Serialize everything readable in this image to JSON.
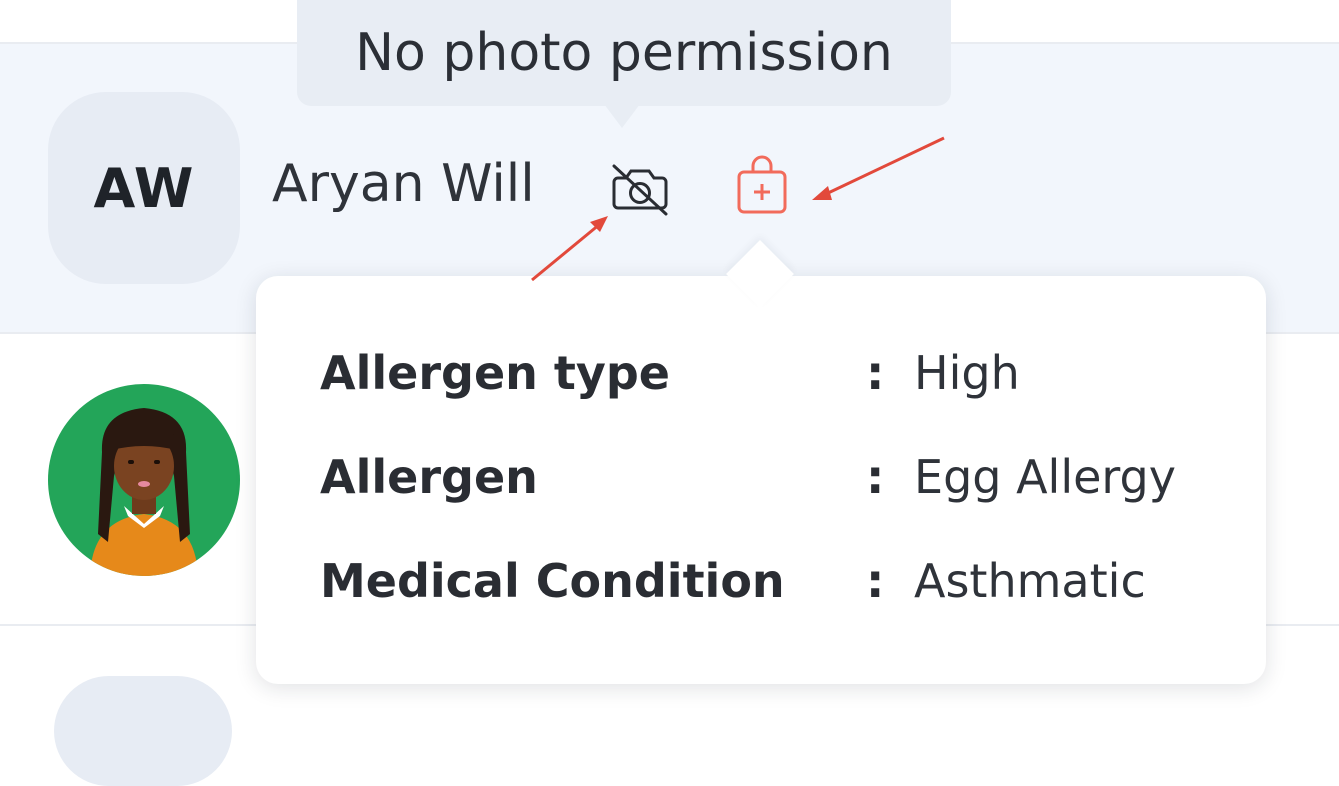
{
  "tooltip": {
    "text": "No photo permission"
  },
  "student": {
    "initials": "AW",
    "name": "Aryan Will"
  },
  "icons": {
    "no_photo": "camera-off-icon",
    "medical": "medical-bag-icon"
  },
  "allergy_popover": {
    "rows": [
      {
        "label": "Allergen type",
        "value": "High"
      },
      {
        "label": "Allergen",
        "value": "Egg Allergy"
      },
      {
        "label": "Medical Condition",
        "value": "Asthmatic"
      }
    ],
    "separator": ":"
  },
  "colors": {
    "accent": "#f26b5b",
    "annotation_arrow": "#e2493b",
    "row_highlight": "#f2f6fc",
    "avatar_bg": "#23a559"
  }
}
